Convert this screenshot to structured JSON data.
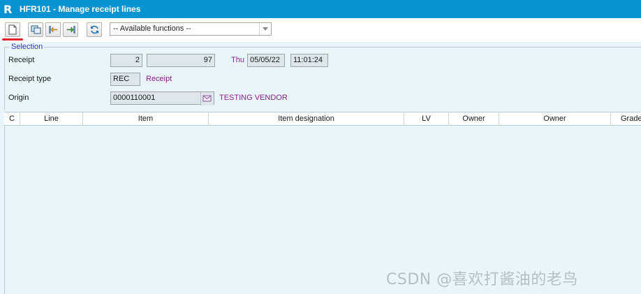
{
  "window": {
    "logo_letter": "R",
    "title": "HFR101 - Manage receipt lines"
  },
  "toolbar": {
    "buttons": [
      {
        "icon": "new-document-icon"
      },
      {
        "icon": "copy-windows-icon"
      },
      {
        "icon": "left-arrow-transfer-icon"
      },
      {
        "icon": "right-arrow-transfer-icon"
      },
      {
        "icon": "refresh-icon"
      }
    ],
    "functions_select": {
      "value": "-- Available functions --"
    }
  },
  "selection": {
    "legend": "Selection",
    "receipt": {
      "label": "Receipt",
      "number": "2",
      "sequence": "97",
      "day": "Thu",
      "date": "05/05/22",
      "time": "11:01:24"
    },
    "receipt_type": {
      "label": "Receipt type",
      "code": "REC",
      "description": "Receipt"
    },
    "origin": {
      "label": "Origin",
      "code": "0000110001",
      "description": "TESTING VENDOR"
    }
  },
  "grid": {
    "columns": [
      "C",
      "Line",
      "Item",
      "Item designation",
      "LV",
      "Owner",
      "Owner",
      "Grade"
    ],
    "rows": []
  },
  "watermark": "CSDN @喜欢打酱油的老鸟",
  "colors": {
    "title_bar": "#0a93d2",
    "legend_text": "#2f2fcf",
    "value_text": "#8a1d8f",
    "highlight_underline": "#e0232a",
    "background": "#eaf5f9"
  }
}
